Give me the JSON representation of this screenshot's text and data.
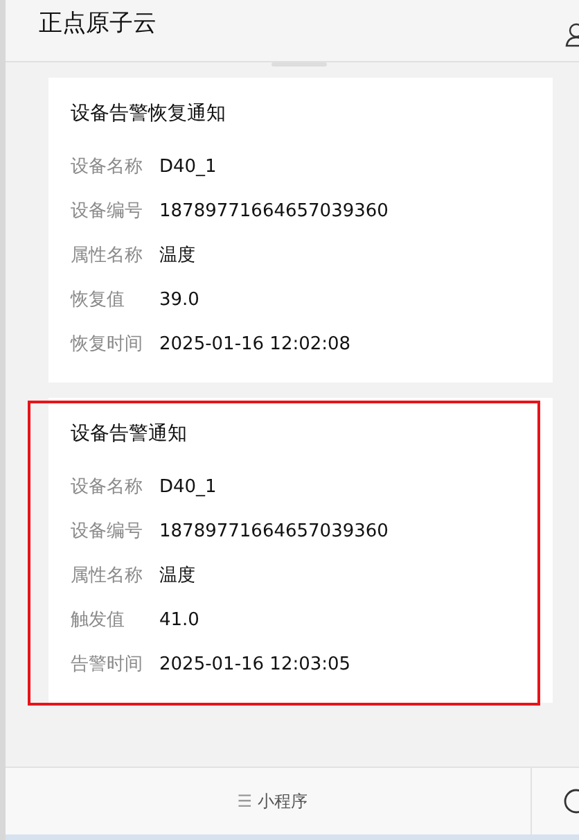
{
  "header": {
    "title": "正点原子云"
  },
  "cards": [
    {
      "title": "设备告警恢复通知",
      "highlighted": false,
      "fields": [
        {
          "label": "设备名称",
          "value": "D40_1"
        },
        {
          "label": "设备编号",
          "value": "18789771664657039360"
        },
        {
          "label": "属性名称",
          "value": "温度"
        },
        {
          "label": "恢复值",
          "value": "39.0"
        },
        {
          "label": "恢复时间",
          "value": "2025-01-16 12:02:08"
        }
      ]
    },
    {
      "title": "设备告警通知",
      "highlighted": true,
      "fields": [
        {
          "label": "设备名称",
          "value": "D40_1"
        },
        {
          "label": "设备编号",
          "value": "18789771664657039360"
        },
        {
          "label": "属性名称",
          "value": "温度"
        },
        {
          "label": "触发值",
          "value": "41.0"
        },
        {
          "label": "告警时间",
          "value": "2025-01-16 12:03:05"
        }
      ]
    }
  ],
  "footer": {
    "menu_icon": "☰",
    "label": "小程序"
  }
}
